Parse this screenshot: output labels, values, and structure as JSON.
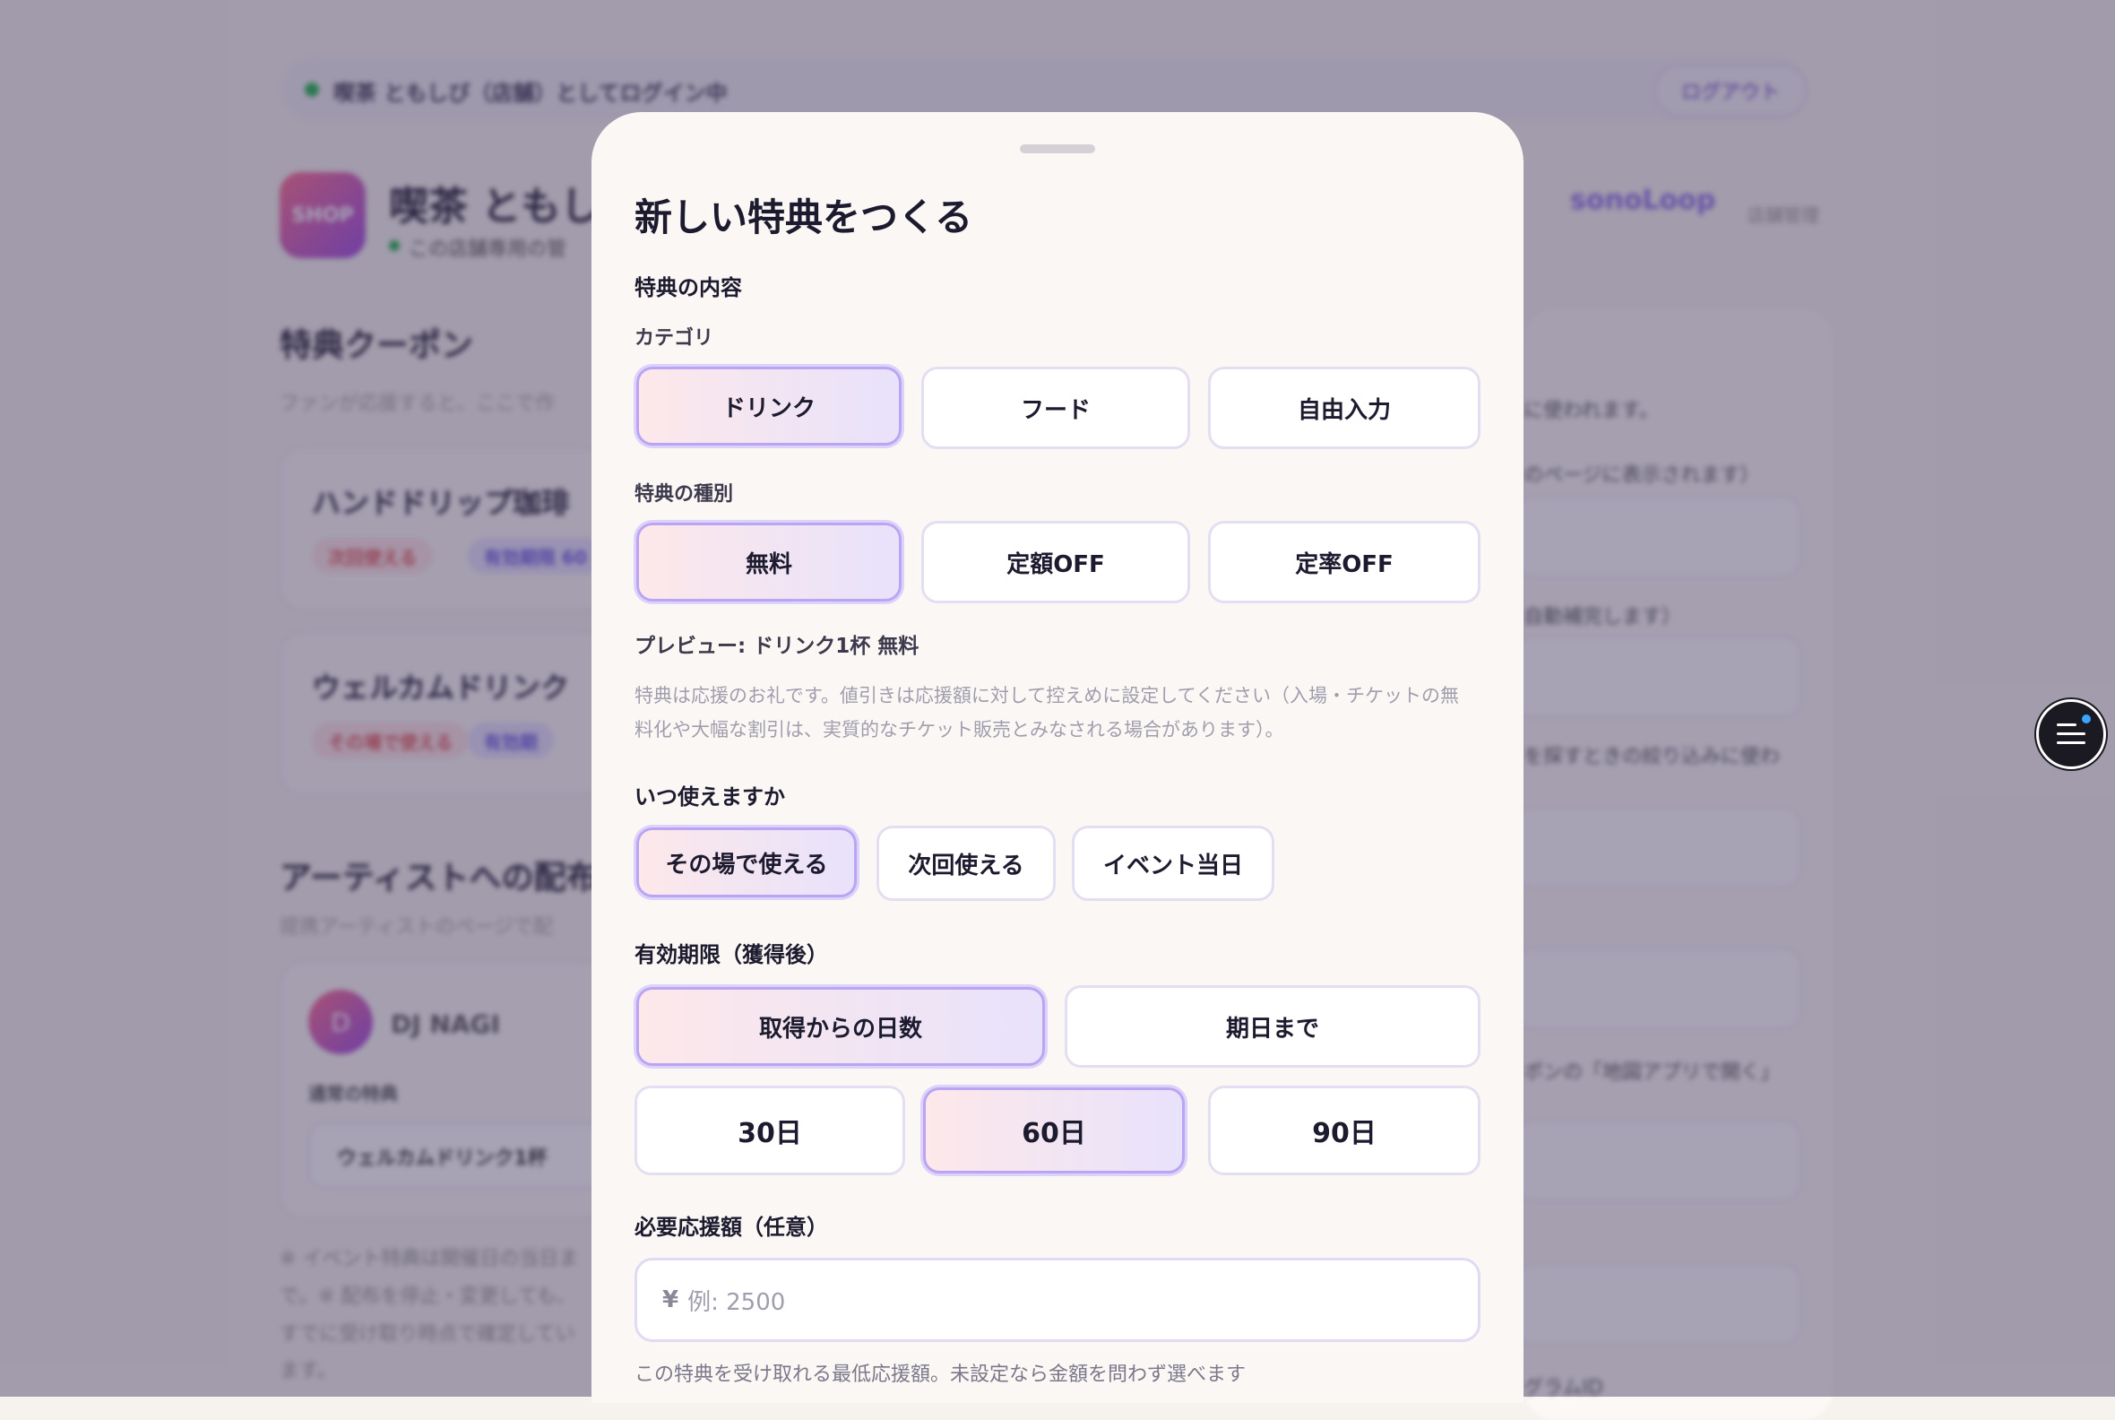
{
  "background": {
    "login_status": "喫茶 ともしび（店舗）としてログイン中",
    "logout_label": "ログアウト",
    "shop_icon_label": "SHOP",
    "shop_name": "喫茶 ともし",
    "shop_subtitle": "この店舗専用の管",
    "brand_name": "sonoLoop",
    "brand_sub": "店舗管理",
    "coupon_heading": "特典クーポン",
    "coupon_desc": "ファンが応援すると、ここで作",
    "coupons": [
      {
        "title": "ハンドドリップ珈琲",
        "chip1": "次回使える",
        "chip2": "有効期限 60"
      },
      {
        "title": "ウェルカムドリンク",
        "chip1": "その場で使える",
        "chip2": "有効期"
      }
    ],
    "artist_heading": "アーティストへの配布",
    "artist_desc": "提携アーティストのページで配",
    "artist": {
      "initial": "D",
      "name": "DJ NAGI",
      "normal_label": "通常の特典",
      "normal_value": "ウェルカムドリンク1杯"
    },
    "note": "※ イベント特典は開催日の当日まで。※ 配布を停止・変更しても、すでに受け取り時点で確定しています。",
    "right_texts": [
      "に使われます。",
      "のページに表示されます）",
      "自動補完します）",
      "を探すときの絞り込みに使わ",
      "ポンの「地図アプリで開く」",
      "グラムID"
    ]
  },
  "modal": {
    "title": "新しい特典をつくる",
    "section_content": "特典の内容",
    "category_label": "カテゴリ",
    "category_options": [
      "ドリンク",
      "フード",
      "自由入力"
    ],
    "type_label": "特典の種別",
    "type_options": [
      "無料",
      "定額OFF",
      "定率OFF"
    ],
    "preview": "プレビュー: ドリンク1杯 無料",
    "notice": "特典は応援のお礼です。値引きは応援額に対して控えめに設定してください（入場・チケットの無料化や大幅な割引は、実質的なチケット販売とみなされる場合があります）。",
    "when_label": "いつ使えますか",
    "when_options": [
      "その場で使える",
      "次回使える",
      "イベント当日"
    ],
    "expiry_label": "有効期限（獲得後）",
    "expiry_mode_options": [
      "取得からの日数",
      "期日まで"
    ],
    "days_options": [
      "30日",
      "60日",
      "90日"
    ],
    "amount_label": "必要応援額（任意）",
    "amount_currency": "¥",
    "amount_placeholder": "例: 2500",
    "amount_helper": "この特典を受け取れる最低応援額。未設定なら金額を問わず選べます"
  }
}
